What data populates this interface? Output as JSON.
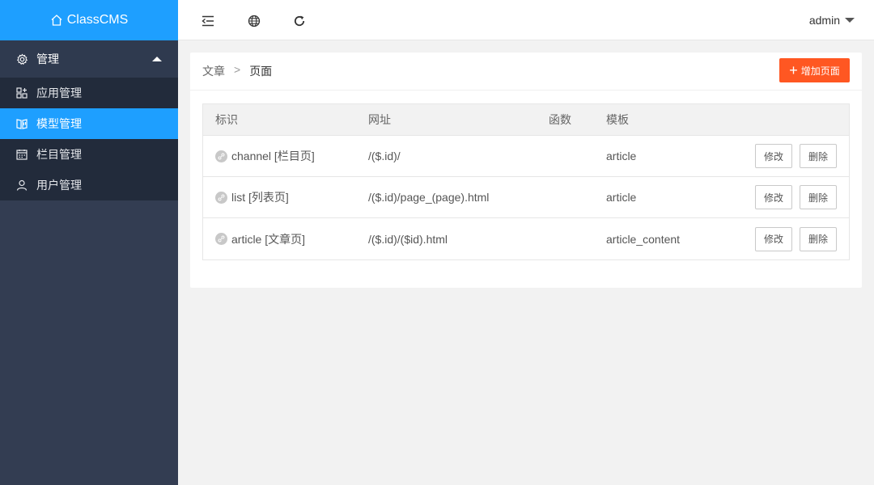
{
  "app": {
    "logo_text": "ClassCMS"
  },
  "sidebar": {
    "group": {
      "label": "管理",
      "icon": "gear-icon"
    },
    "items": [
      {
        "label": "应用管理",
        "icon": "apps-icon",
        "active": false
      },
      {
        "label": "模型管理",
        "icon": "model-icon",
        "active": true
      },
      {
        "label": "栏目管理",
        "icon": "calendar-icon",
        "active": false
      },
      {
        "label": "用户管理",
        "icon": "user-icon",
        "active": false
      }
    ]
  },
  "header": {
    "icons": [
      "menu-collapse-icon",
      "globe-icon",
      "refresh-icon"
    ],
    "user": "admin"
  },
  "breadcrumb": {
    "parent": "文章",
    "separator": ">",
    "current": "页面"
  },
  "toolbar": {
    "add_label": "增加页面"
  },
  "table": {
    "headers": {
      "id": "标识",
      "url": "网址",
      "func": "函数",
      "template": "模板"
    },
    "rows": [
      {
        "id": "channel [栏目页]",
        "url": "/($.id)/",
        "func": "",
        "template": "article",
        "edit": "修改",
        "delete": "删除"
      },
      {
        "id": "list [列表页]",
        "url": "/($.id)/page_(page).html",
        "func": "",
        "template": "article",
        "edit": "修改",
        "delete": "删除"
      },
      {
        "id": "article [文章页]",
        "url": "/($.id)/($id).html",
        "func": "",
        "template": "article_content",
        "edit": "修改",
        "delete": "删除"
      }
    ]
  },
  "colors": {
    "primary": "#1e9fff",
    "sidebar": "#333d52",
    "submenu": "#222b3b",
    "danger": "#ff5722"
  }
}
